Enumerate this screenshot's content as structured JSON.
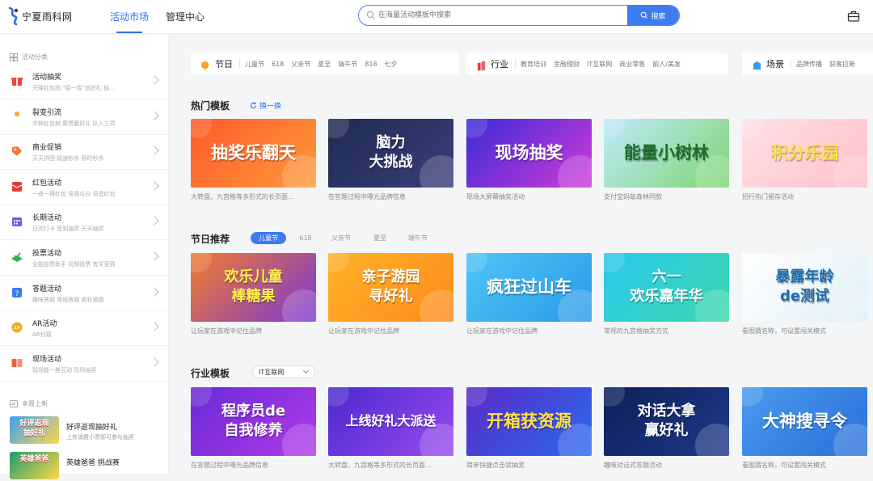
{
  "header": {
    "logo_text": "宁夏雨科网",
    "nav": [
      "活动市场",
      "管理中心"
    ],
    "search_placeholder": "在海量活动模板中搜索",
    "search_button": "搜索"
  },
  "sidebar": {
    "categories_heading": "活动分类",
    "items": [
      {
        "title": "活动抽奖",
        "sub": "天降红包雨    \"摇一摇\"送好礼    抽...",
        "icon": "gift-icon",
        "color": "#f0463c"
      },
      {
        "title": "裂变引流",
        "sub": "齐种红包树    集赞赢好礼    队人三项",
        "icon": "user-icon",
        "color": "#f5a623"
      },
      {
        "title": "商业促销",
        "sub": "天天拼团    极速秒杀    限时秒杀",
        "icon": "tag-icon",
        "color": "#f27b3a"
      },
      {
        "title": "红包活动",
        "sub": "一夜一得红包    竞猜瓜分    语音红包",
        "icon": "envelope-icon",
        "color": "#e83b3b"
      },
      {
        "title": "长期活动",
        "sub": "日历打卡    签到抽奖    天天抽奖",
        "icon": "calendar-icon",
        "color": "#6b5cf0"
      },
      {
        "title": "投票活动",
        "sub": "全能投票助手    视频投票    有奖竞猜",
        "icon": "vote-icon",
        "color": "#2cb44a"
      },
      {
        "title": "答题活动",
        "sub": "趣味答题    常规答题    疯狂猜图",
        "icon": "question-icon",
        "color": "#3e7af0"
      },
      {
        "title": "AR活动",
        "sub": "AR扫福",
        "icon": "ar-icon",
        "color": "#f5a623"
      },
      {
        "title": "现场活动",
        "sub": "现场能一推互动    现场抽奖",
        "icon": "screen-icon",
        "color": "#f0603c"
      }
    ],
    "news_heading": "本周上新",
    "news": [
      {
        "title": "好评返现抽好礼",
        "sub": "上传消费小票即可参与抽奖",
        "thumb_text": "好评返现\n抽好礼",
        "colors": [
          "#3aa0f5",
          "#ffd84a"
        ]
      },
      {
        "title": "英雄爸爸 挑战赛",
        "sub": "",
        "thumb_text": "英雄爸爸",
        "colors": [
          "#1c9c6a",
          "#ffd84a"
        ]
      }
    ]
  },
  "main": {
    "category_bars": [
      {
        "name": "节日",
        "tags": [
          "儿童节",
          "618",
          "父亲节",
          "夏至",
          "端午节",
          "818",
          "七夕"
        ],
        "icon": "festival-icon",
        "color": "#f5a623"
      },
      {
        "name": "行业",
        "tags": [
          "教育培训",
          "金融理财",
          "IT互联网",
          "商业零售",
          "丽人/美发"
        ],
        "icon": "industry-icon",
        "color": "#e83b3b"
      },
      {
        "name": "场景",
        "tags": [
          "品牌传播",
          "获客拉新"
        ],
        "icon": "scene-icon",
        "color": "#3e9af0"
      }
    ],
    "hot": {
      "title": "热门模板",
      "refresh": "换一换",
      "cards": [
        {
          "banner": "抽奖乐翻天",
          "desc": "大转盘、九宫格等多形式的长页面...",
          "colors": [
            "#ff5a2a",
            "#ff9a3a"
          ],
          "text_color": "#fff"
        },
        {
          "banner": "脑力\n大挑战",
          "desc": "在答题过程中曝光品牌信息",
          "colors": [
            "#1f2b52",
            "#3a3f7a"
          ],
          "text_color": "#fff"
        },
        {
          "banner": "现场抽奖",
          "desc": "现场大屏幕抽奖活动",
          "colors": [
            "#3a2bd8",
            "#d23ad8"
          ],
          "text_color": "#fff"
        },
        {
          "banner": "能量小树林",
          "desc": "支付宝蚂蚁森林同款",
          "colors": [
            "#bfeaff",
            "#7ed56f"
          ],
          "text_color": "#1c6b2a"
        },
        {
          "banner": "积分乐园",
          "desc": "招行热门留存活动",
          "colors": [
            "#ffe1e6",
            "#ffc0c9"
          ],
          "text_color": "#ffe14a"
        }
      ]
    },
    "festival": {
      "title": "节日推荐",
      "tabs": [
        "儿童节",
        "618",
        "父亲节",
        "夏至",
        "端午节"
      ],
      "active_tab": 0,
      "cards": [
        {
          "banner": "欢乐儿童\n棒糖果",
          "desc": "让玩家在游戏中记住品牌",
          "colors": [
            "#f27b2a",
            "#7a3ad8"
          ],
          "text_color": "#fff14a"
        },
        {
          "banner": "亲子游园\n寻好礼",
          "desc": "让玩家在游戏中记住品牌",
          "colors": [
            "#ffb22a",
            "#ff8a1a"
          ],
          "text_color": "#fff"
        },
        {
          "banner": "疯狂过山车",
          "desc": "让玩家在游戏中记住品牌",
          "colors": [
            "#4ec4f5",
            "#2a9ae8"
          ],
          "text_color": "#fff"
        },
        {
          "banner": "六一\n欢乐嘉年华",
          "desc": "常规的九宫格抽奖方式",
          "colors": [
            "#2ac8f0",
            "#3ad8a8"
          ],
          "text_color": "#fff"
        },
        {
          "banner": "暴露年龄\nde测试",
          "desc": "看图猜名称，可设置闯关模式",
          "colors": [
            "#ffffff",
            "#dff0f8"
          ],
          "text_color": "#1a6bb0"
        }
      ]
    },
    "industry": {
      "title": "行业模板",
      "selected": "IT互联网",
      "cards": [
        {
          "banner": "程序员de\n自我修养",
          "desc": "在答题过程中曝光品牌信息",
          "colors": [
            "#6a2ad8",
            "#b23ae8"
          ],
          "text_color": "#fff"
        },
        {
          "banner": "上线好礼大派送",
          "desc": "大转盘、九宫格等多形式的长页面...",
          "colors": [
            "#4a2ad0",
            "#9a4af0"
          ],
          "text_color": "#fff"
        },
        {
          "banner": "开箱获资源",
          "desc": "简单快捷点击就抽奖",
          "colors": [
            "#5a2ac8",
            "#2a6af0"
          ],
          "text_color": "#ffe14a"
        },
        {
          "banner": "对话大拿\n赢好礼",
          "desc": "趣味对话式答题活动",
          "colors": [
            "#0e1f5a",
            "#1f3a8a"
          ],
          "text_color": "#fff"
        },
        {
          "banner": "大神搜寻令",
          "desc": "看图猜名称，可设置闯关模式",
          "colors": [
            "#4a9af0",
            "#2a70d8"
          ],
          "text_color": "#fff"
        }
      ]
    }
  }
}
